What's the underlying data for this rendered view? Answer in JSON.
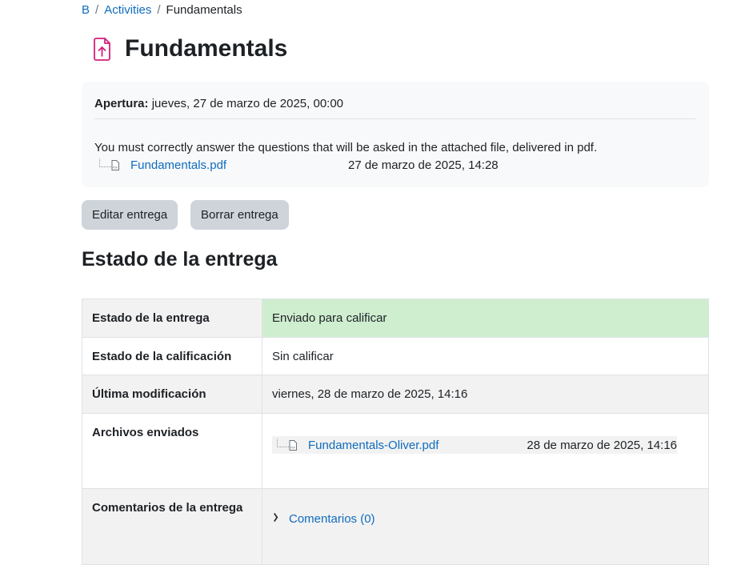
{
  "breadcrumb": {
    "items": [
      "B",
      "Activities"
    ],
    "separator": "/",
    "current": "Fundamentals"
  },
  "page": {
    "title": "Fundamentals",
    "icon": "assignment-upload-icon",
    "icon_color": "#d41e78"
  },
  "intro": {
    "opening_label": "Apertura:",
    "opening_value": "jueves, 27 de marzo de 2025, 00:00",
    "description": "You must correctly answer the questions that will be asked in the attached file, delivered in pdf.",
    "attachment": {
      "name": "Fundamentals.pdf",
      "date": "27 de marzo de 2025, 14:28"
    }
  },
  "actions": {
    "edit_label": "Editar entrega",
    "delete_label": "Borrar entrega"
  },
  "status_section": {
    "heading": "Estado de la entrega",
    "rows": {
      "submission_status": {
        "label": "Estado de la entrega",
        "value": "Enviado para calificar",
        "color": "#cfeed0"
      },
      "grading_status": {
        "label": "Estado de la calificación",
        "value": "Sin calificar"
      },
      "last_modified": {
        "label": "Última modificación",
        "value": "viernes, 28 de marzo de 2025, 14:16"
      },
      "files": {
        "label": "Archivos enviados",
        "file_name": "Fundamentals-Oliver.pdf",
        "file_date": "28 de marzo de 2025, 14:16"
      },
      "comments": {
        "label": "Comentarios de la entrega",
        "link": "Comentarios (0)"
      }
    }
  },
  "colors": {
    "link": "#0f6cbf",
    "button_bg": "#ced4da",
    "panel_bg": "#f8f9fa"
  }
}
